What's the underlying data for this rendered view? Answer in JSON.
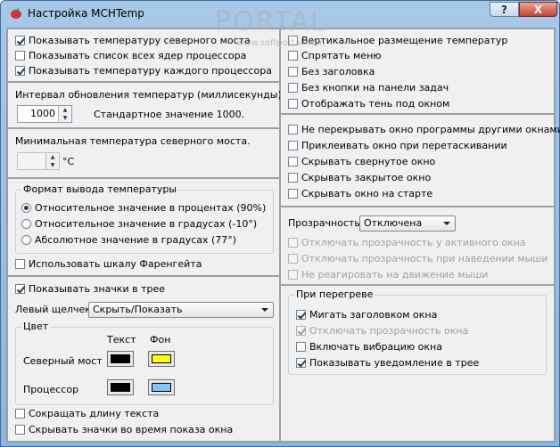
{
  "window": {
    "title": "Настройка MCHTemp",
    "help": "?",
    "close": "X"
  },
  "watermark": {
    "brand": "PORTAL",
    "url": "www.softportal.com"
  },
  "p1": {
    "show_nb_temp": "Показывать температуру северного моста",
    "show_core_list": "Показывать список всех ядер процессора",
    "show_each_cpu": "Показывать температуру каждого процессора"
  },
  "p2": {
    "label": "Интервал обновления температур (миллисекунды).",
    "value": "1000",
    "default": "Стандартное значение 1000."
  },
  "p3": {
    "label": "Минимальная температура северного моста.",
    "unit": "°C"
  },
  "p4": {
    "group": "Формат вывода температуры",
    "opt1": "Относительное значение в процентах (90%)",
    "opt2": "Относительное значение в градусах (-10°)",
    "opt3": "Абсолютное значение в градусах (77°)",
    "fahrenheit": "Использовать шкалу Фаренгейта"
  },
  "p5": {
    "tray_icons": "Показывать значки в трее",
    "left_click": "Левый щелчек",
    "left_click_value": "Скрыть/Показать",
    "color_group": "Цвет",
    "col_text": "Текст",
    "col_bg": "Фон",
    "row_nb": "Северный мост",
    "row_cpu": "Процессор",
    "shorten": "Сокращать длину текста",
    "hide_icons": "Скрывать значки во время показа окна"
  },
  "colors": {
    "nb_text": "#000000",
    "nb_bg": "#ffff00",
    "cpu_text": "#000000",
    "cpu_bg": "#80c8f8"
  },
  "r1": {
    "vertical": "Вертикальное размещение температур",
    "hide_menu": "Спрятать меню",
    "no_title": "Без заголовка",
    "no_taskbar": "Без кнопки на панели задач",
    "shadow": "Отображать тень под окном"
  },
  "r2": {
    "no_overlap": "Не перекрывать окно программы другими окнами",
    "stick": "Приклеивать окно при перетаскивании",
    "hide_collapsed": "Скрывать свернутое окно",
    "hide_closed": "Скрывать закрытое окно",
    "hide_start": "Скрывать окно на старте"
  },
  "r3": {
    "label": "Прозрачность",
    "value": "Отключена",
    "opt1": "Отключать прозрачность у активного окна",
    "opt2": "Отключать прозрачность при наведении мыши",
    "opt3": "Не реагировать на движение мыши"
  },
  "r4": {
    "group": "При перегреве",
    "blink": "Мигать заголовком окна",
    "disable_transp": "Отключать прозрачность окна",
    "vibrate": "Включать вибрацию окна",
    "notify": "Показывать уведомление в трее"
  }
}
